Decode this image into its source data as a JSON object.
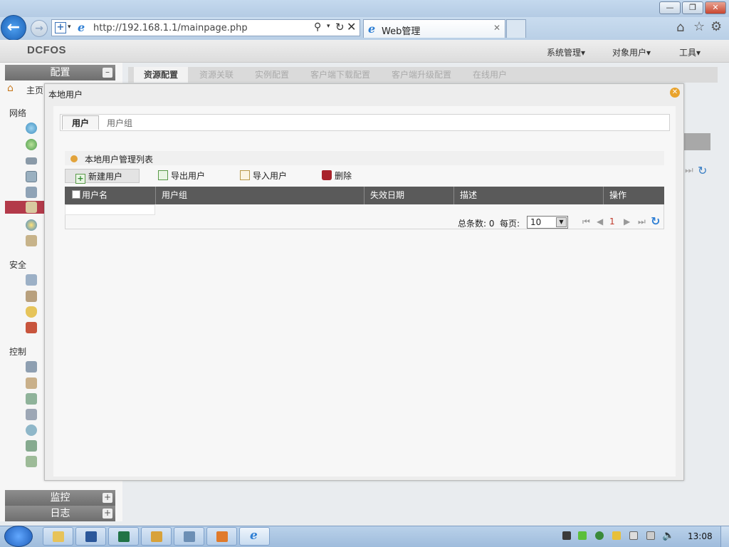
{
  "browser": {
    "address": "http://192.168.1.1/mainpage.php",
    "tab_title": "Web管理",
    "window_buttons": [
      "—",
      "❐",
      "✕"
    ]
  },
  "app": {
    "logo": "DCFOS",
    "menus": [
      "系统管理▾",
      "对象用户▾",
      "工具▾"
    ]
  },
  "sidebar": {
    "config_header": "配置",
    "home_label": "主页",
    "categories": [
      "网络",
      "安全",
      "控制"
    ],
    "bottom_sections": [
      "监控",
      "日志"
    ],
    "collapse_symbol": "–",
    "expand_symbol": "+"
  },
  "content_tabs": [
    "资源配置",
    "资源关联",
    "实例配置",
    "客户端下载配置",
    "客户端升级配置",
    "在线用户"
  ],
  "modal": {
    "title": "本地用户",
    "tabs": [
      "用户",
      "用户组"
    ],
    "list_title": "本地用户管理列表",
    "toolbar": {
      "new_user": "新建用户",
      "export_users": "导出用户",
      "import_users": "导入用户",
      "delete": "删除"
    },
    "columns": [
      "用户名",
      "用户组",
      "失效日期",
      "描述",
      "操作"
    ],
    "pager": {
      "total": "总条数: 0",
      "per_page_label": "每页:",
      "per_page_value": "10",
      "current_page": "1"
    }
  },
  "taskbar": {
    "clock": "13:08"
  },
  "colors": {
    "accent": "#b33a4a",
    "grid_header": "#5a5a5a",
    "dot": "#e2a33b"
  }
}
